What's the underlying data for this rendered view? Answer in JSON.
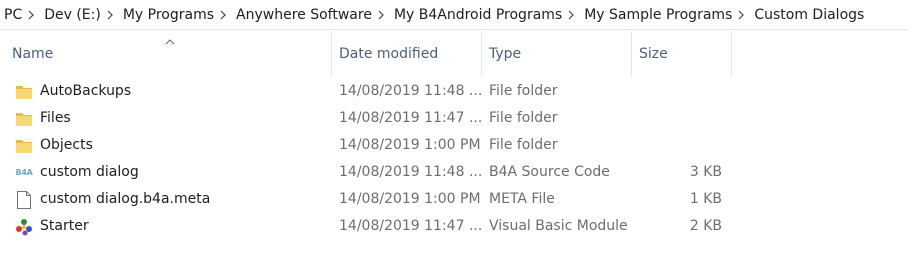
{
  "breadcrumb": [
    "PC",
    "Dev (E:)",
    "My Programs",
    "Anywhere Software",
    "My B4Android Programs",
    "My Sample Programs",
    "Custom Dialogs"
  ],
  "columns": {
    "name": "Name",
    "date": "Date modified",
    "type": "Type",
    "size": "Size"
  },
  "files": [
    {
      "icon": "folder-icon",
      "name": "AutoBackups",
      "date": "14/08/2019 11:48 ...",
      "type": "File folder",
      "size": ""
    },
    {
      "icon": "folder-icon",
      "name": "Files",
      "date": "14/08/2019 11:47 ...",
      "type": "File folder",
      "size": ""
    },
    {
      "icon": "folder-icon",
      "name": "Objects",
      "date": "14/08/2019 1:00 PM",
      "type": "File folder",
      "size": ""
    },
    {
      "icon": "b4a-file-icon",
      "name": "custom dialog",
      "date": "14/08/2019 11:48 ...",
      "type": "B4A Source Code",
      "size": "3 KB"
    },
    {
      "icon": "blank-file-icon",
      "name": "custom dialog.b4a.meta",
      "date": "14/08/2019 1:00 PM",
      "type": "META File",
      "size": "1 KB"
    },
    {
      "icon": "vb-module-icon",
      "name": "Starter",
      "date": "14/08/2019 11:47 ...",
      "type": "Visual Basic Module",
      "size": "2 KB"
    }
  ],
  "b4a_icon_text": "B4A"
}
